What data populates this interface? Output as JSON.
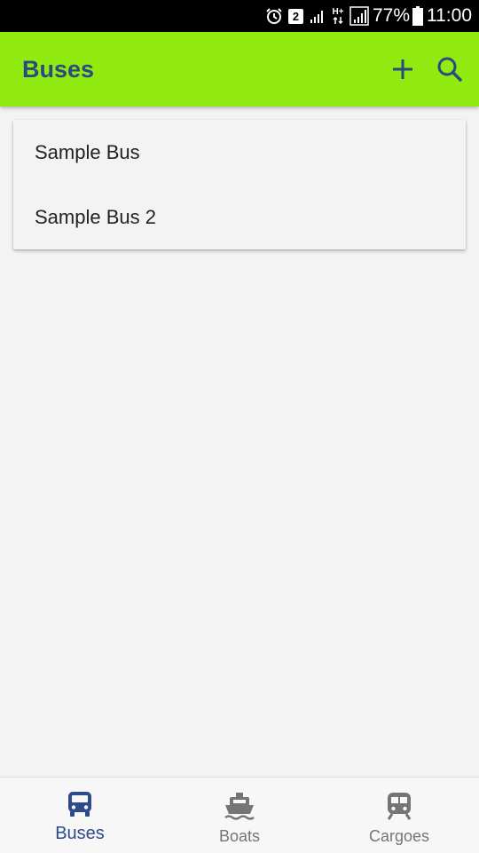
{
  "status_bar": {
    "notification_count": "2",
    "network_type": "H+",
    "battery_percent": "77%",
    "time": "11:00",
    "icons": [
      "alarm-icon",
      "notification-badge",
      "signal-icon",
      "data-arrows-icon",
      "signal-strength-icon",
      "battery-icon"
    ]
  },
  "app_bar": {
    "title": "Buses",
    "background_color": "#91ea10",
    "title_color": "#2b4a7e",
    "actions": [
      "add-icon",
      "search-icon"
    ]
  },
  "list": {
    "items": [
      {
        "label": "Sample Bus"
      },
      {
        "label": "Sample Bus 2"
      }
    ]
  },
  "bottom_nav": {
    "active_color": "#2d4a8a",
    "inactive_color": "#757575",
    "items": [
      {
        "label": "Buses",
        "icon": "bus-icon",
        "active": true
      },
      {
        "label": "Boats",
        "icon": "boat-icon",
        "active": false
      },
      {
        "label": "Cargoes",
        "icon": "train-icon",
        "active": false
      }
    ]
  }
}
